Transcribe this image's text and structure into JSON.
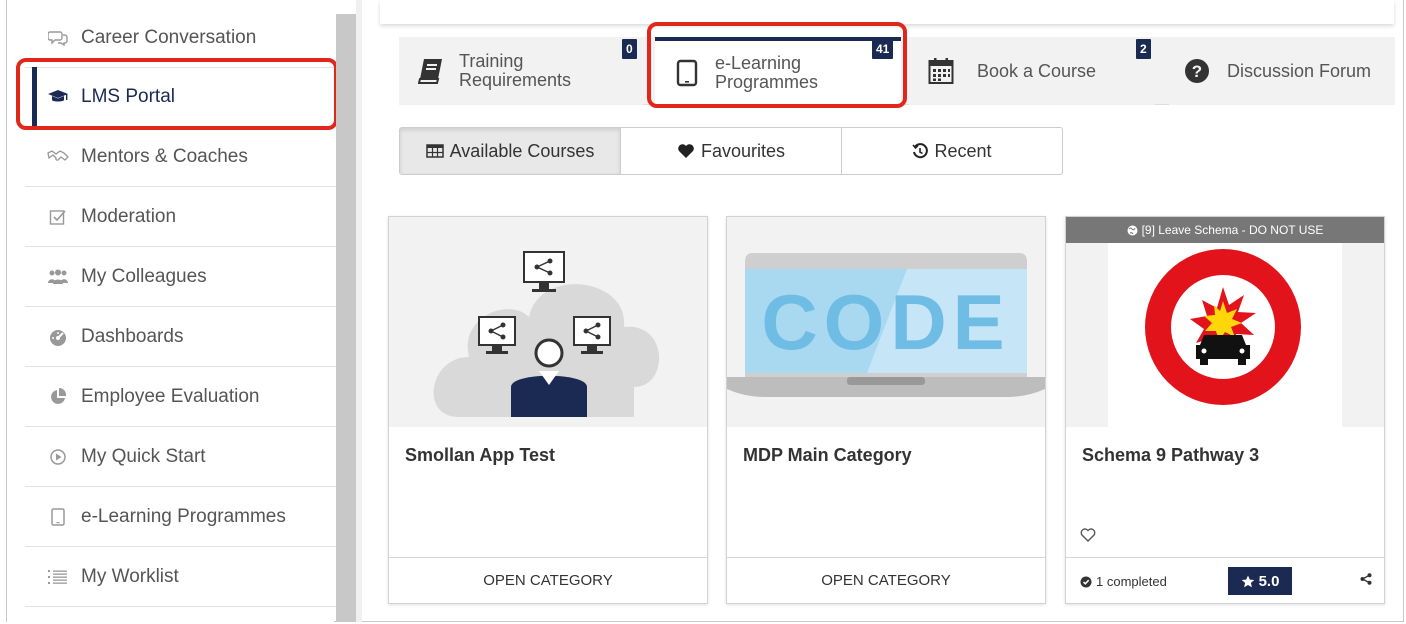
{
  "sidebar": {
    "items": [
      {
        "label": "Career Conversation",
        "icon": "chat-bubbles-icon"
      },
      {
        "label": "LMS Portal",
        "icon": "graduation-cap-icon",
        "active": true
      },
      {
        "label": "Mentors & Coaches",
        "icon": "handshake-icon"
      },
      {
        "label": "Moderation",
        "icon": "checkbox-pencil-icon"
      },
      {
        "label": "My Colleagues",
        "icon": "users-icon"
      },
      {
        "label": "Dashboards",
        "icon": "dashboard-gauge-icon"
      },
      {
        "label": "Employee Evaluation",
        "icon": "pie-chart-icon"
      },
      {
        "label": "My Quick Start",
        "icon": "play-circle-icon"
      },
      {
        "label": "e-Learning Programmes",
        "icon": "tablet-icon"
      },
      {
        "label": "My Worklist",
        "icon": "list-icon"
      }
    ]
  },
  "tabs": [
    {
      "label_line1": "Training",
      "label_line2": "Requirements",
      "badge": "0",
      "icon": "book-icon"
    },
    {
      "label_line1": "e-Learning",
      "label_line2": "Programmes",
      "badge": "41",
      "icon": "tablet-icon",
      "active": true
    },
    {
      "label": "Book a Course",
      "badge": "2",
      "icon": "calendar-icon"
    },
    {
      "label": "Discussion Forum",
      "icon": "question-circle-icon"
    }
  ],
  "filters": [
    {
      "label": "Available Courses",
      "icon": "table-icon",
      "active": true
    },
    {
      "label": "Favourites",
      "icon": "heart-icon"
    },
    {
      "label": "Recent",
      "icon": "history-icon"
    }
  ],
  "cards": [
    {
      "title": "Smollan App Test",
      "footer": "OPEN CATEGORY",
      "image": "network-person-illustration"
    },
    {
      "title": "MDP Main Category",
      "footer": "OPEN CATEGORY",
      "image": "laptop-code-illustration",
      "image_text": "CODE"
    },
    {
      "title": "Schema 9 Pathway 3",
      "ribbon": "[9] Leave Schema - DO NOT USE",
      "image": "no-vehicles-explosion-sign",
      "completed": "1 completed",
      "rating": "5.0"
    }
  ],
  "colors": {
    "navy": "#1a2a52",
    "highlight_red": "#e1261c",
    "ribbon_gray": "#777777"
  }
}
